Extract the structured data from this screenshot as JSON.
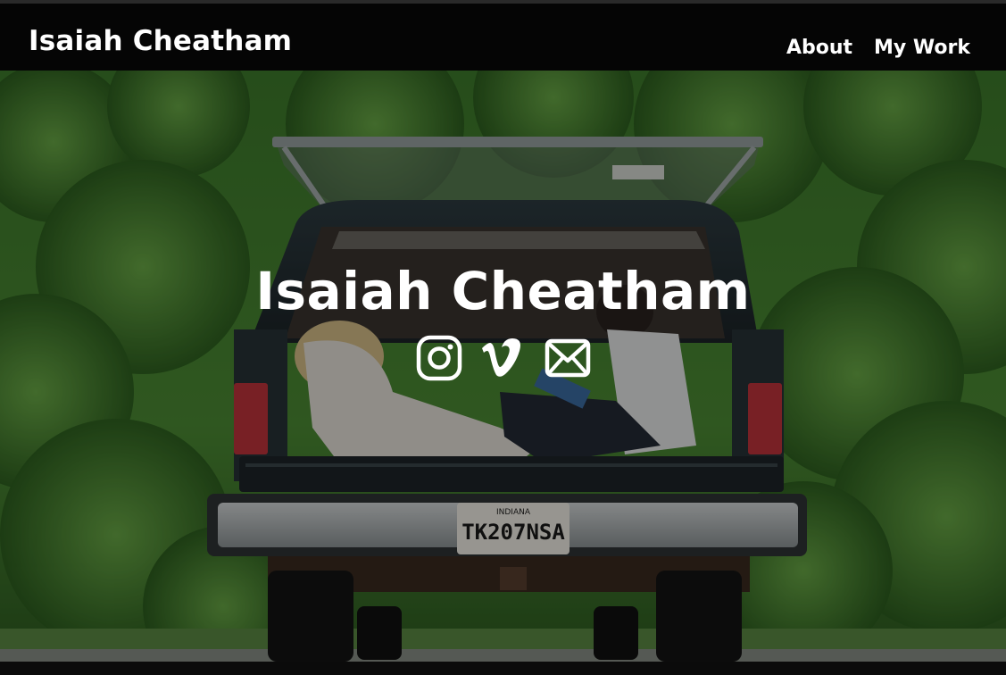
{
  "nav": {
    "brand": "Isaiah Cheatham",
    "links": [
      {
        "label": "About"
      },
      {
        "label": "My Work"
      }
    ]
  },
  "hero": {
    "title": "Isaiah Cheatham",
    "background": "photo of a pickup truck with open topper parked in front of green trees, two people sitting in the truck bed",
    "license_plate_state": "INDIANA",
    "license_plate": "TK207NSA",
    "social_icons": [
      {
        "icon": "instagram-icon"
      },
      {
        "icon": "vimeo-icon"
      },
      {
        "icon": "envelope-icon"
      }
    ]
  },
  "colors": {
    "nav_bg": "#050505",
    "text": "#ffffff",
    "foliage": "#3f7a2e"
  }
}
